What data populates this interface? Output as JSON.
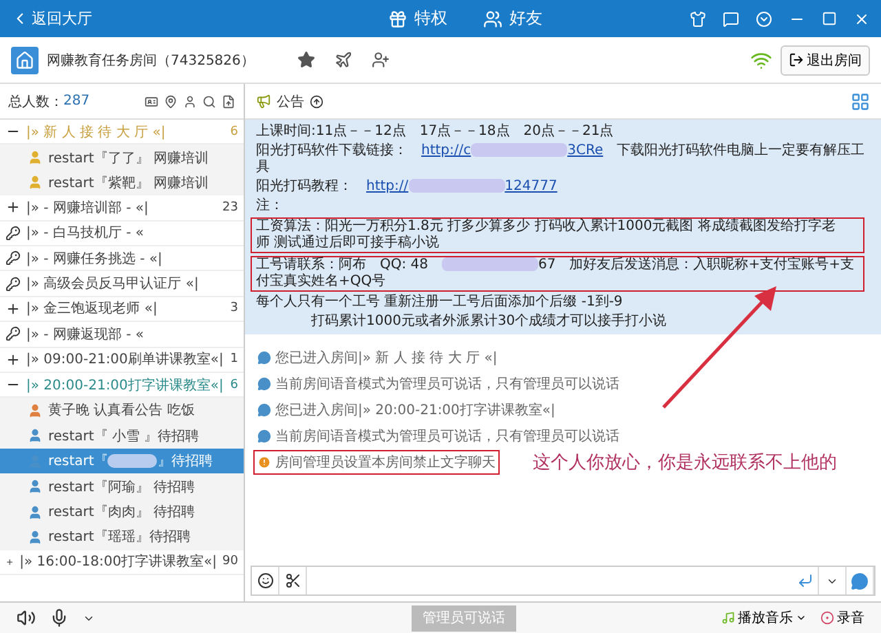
{
  "top_bar": {
    "back": "返回大厅",
    "tabs": [
      {
        "label": "特权",
        "kind": "gift"
      },
      {
        "label": "好友",
        "kind": "friends"
      }
    ]
  },
  "room": {
    "name": "网赚教育任务房间（74325826）",
    "exit": "退出房间"
  },
  "members": {
    "label": "总人数：",
    "count": "287"
  },
  "channels": [
    {
      "kind": "open",
      "name": "|»  新 人 接 待 大 厅  «|",
      "count": "6",
      "color": "#c8a040",
      "children": [
        {
          "name": "restart『了了』 网赚培训",
          "color": "#e0b030",
          "selected": false
        },
        {
          "name": "restart『紫靶』 网赚培训",
          "color": "#e0b030",
          "selected": false
        }
      ]
    },
    {
      "kind": "closed",
      "name": "|»  - 网赚培训部 -  «|",
      "count": "23",
      "color": "#444444"
    },
    {
      "kind": "locked",
      "name": "|»  - 白马技机厅 -  «",
      "color": "#444444"
    },
    {
      "kind": "locked",
      "name": "|» - 网赚任务挑选 - «|",
      "color": "#444444"
    },
    {
      "kind": "locked",
      "name": "|» 高级会员反马甲认证厅 «|",
      "color": "#444444"
    },
    {
      "kind": "closed",
      "name": "|»  金三饱返现老师  «|",
      "count": "3",
      "color": "#444444"
    },
    {
      "kind": "locked",
      "name": "|»  - 网赚返现部 -  «",
      "color": "#444444"
    },
    {
      "kind": "closed",
      "name": "|» 09:00-21:00刷单讲课教室«|",
      "count": "1",
      "color": "#444444"
    },
    {
      "kind": "open",
      "name": "|» 20:00-21:00打字讲课教室«|",
      "count": "6",
      "color": "#2a8a8a",
      "children": [
        {
          "name": "黄子晚  认真看公告  吃饭",
          "color": "#e08040",
          "selected": false
        },
        {
          "name": "restart『 小雪 』待招聘",
          "color": "#4a90c8",
          "selected": false
        },
        {
          "name": "restart『",
          "hidden_part": true,
          "suffix": "』待招聘",
          "color": "#4a90c8",
          "selected": true
        },
        {
          "name": "restart『阿瑜』 待招聘",
          "color": "#4a90c8",
          "selected": false
        },
        {
          "name": "restart『肉肉』 待招聘",
          "color": "#4a90c8",
          "selected": false
        },
        {
          "name": "restart『瑶瑶』待招聘",
          "color": "#4a90c8",
          "selected": false
        }
      ]
    },
    {
      "kind": "closed",
      "name": "|» 16:00-18:00打字讲课教室«|",
      "count": "90",
      "color": "#444444"
    }
  ],
  "announcement": {
    "title": "公告",
    "lines": [
      {
        "boxed": false,
        "segments": [
          {
            "kind": "plain",
            "text": "上课时间:11点－－12点"
          },
          {
            "kind": "plain",
            "text": "17点－－18点"
          },
          {
            "kind": "plain",
            "text": "20点－－21点"
          }
        ]
      },
      {
        "boxed": false,
        "segments": [
          {
            "kind": "plain",
            "text": "阳光打码软件下载链接："
          },
          {
            "kind": "link",
            "text": "http://c"
          },
          {
            "kind": "blur"
          },
          {
            "kind": "link",
            "text": "3CRe"
          },
          {
            "kind": "plain",
            "text": "　下载阳光打码软件电脑上一定要有解压工具"
          }
        ]
      },
      {
        "boxed": false,
        "segments": [
          {
            "kind": "plain",
            "text": "阳光打码教程："
          },
          {
            "kind": "link",
            "text": "http://"
          },
          {
            "kind": "blur"
          },
          {
            "kind": "link",
            "text": "124777"
          }
        ]
      },
      {
        "boxed": false,
        "segments": [
          {
            "kind": "plain",
            "text": "注："
          }
        ]
      },
      {
        "boxed": true,
        "segments": [
          {
            "kind": "plain",
            "text": "工资算法：阳光一万积分1.8元 打多少算多少 打码收入累计1000元截图 将成绩截图发给打字老师 测试通过后即可接手稿小说"
          }
        ]
      },
      {
        "boxed": true,
        "segments": [
          {
            "kind": "plain",
            "text": "工号请联系：阿布　QQ: 48"
          },
          {
            "kind": "blur"
          },
          {
            "kind": "plain",
            "text": "67　加好友后发送消息：入职昵称+支付宝账号+支付宝真实姓名+QQ号"
          }
        ]
      },
      {
        "boxed": false,
        "segments": [
          {
            "kind": "plain",
            "text": "每个人只有一个工号  重新注册一工号后面添加个后缀 -1到-9"
          }
        ]
      },
      {
        "boxed": false,
        "segments": [
          {
            "kind": "plain",
            "text": "　　　　打码累计1000元或者外派累计30个成绩才可以接手打小说"
          }
        ]
      }
    ]
  },
  "chat": [
    {
      "kind": "info",
      "text": "您已进入房间|»  新 人 接 待 大 厅  «|",
      "boxed": false
    },
    {
      "kind": "info",
      "text": "当前房间语音模式为管理员可说话，只有管理员可以说话",
      "boxed": false
    },
    {
      "kind": "info",
      "text": "您已进入房间|» 20:00-21:00打字讲课教室«|",
      "boxed": false
    },
    {
      "kind": "info",
      "text": "当前房间语音模式为管理员可说话，只有管理员可以说话",
      "boxed": false
    },
    {
      "kind": "warning",
      "text": "房间管理员设置本房间禁止文字聊天",
      "boxed": true
    }
  ],
  "annotation": {
    "text": "这个人你放心，你是永远联系不上他的"
  },
  "bottom_bar": {
    "speak_button": {
      "label": "管理员可说话",
      "disabled": true
    },
    "music": "播放音乐",
    "record": "录音"
  }
}
